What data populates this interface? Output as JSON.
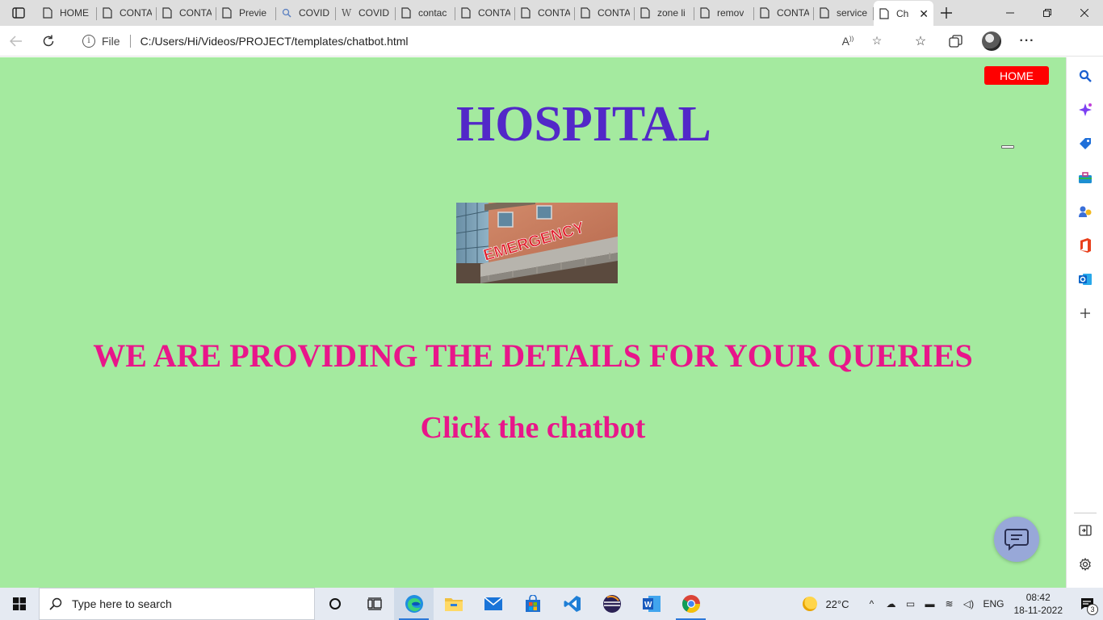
{
  "browser": {
    "tabs": [
      {
        "label": "HOME",
        "icon": "page-icon"
      },
      {
        "label": "CONTA",
        "icon": "page-icon"
      },
      {
        "label": "CONTA",
        "icon": "page-icon"
      },
      {
        "label": "Previe",
        "icon": "page-icon"
      },
      {
        "label": "COVID",
        "icon": "search-icon"
      },
      {
        "label": "COVID",
        "icon": "wikipedia-icon"
      },
      {
        "label": "contac",
        "icon": "page-icon"
      },
      {
        "label": "CONTA",
        "icon": "page-icon"
      },
      {
        "label": "CONTA",
        "icon": "page-icon"
      },
      {
        "label": "CONTA",
        "icon": "page-icon"
      },
      {
        "label": "zone li",
        "icon": "page-icon"
      },
      {
        "label": "remov",
        "icon": "page-icon"
      },
      {
        "label": "CONTA",
        "icon": "page-icon"
      },
      {
        "label": "service",
        "icon": "page-icon"
      }
    ],
    "active_tab": {
      "label": "Ch",
      "icon": "page-icon"
    },
    "address": {
      "scheme_label": "File",
      "url": "C:/Users/Hi/Videos/PROJECT/templates/chatbot.html"
    }
  },
  "page": {
    "home_button": "HOME",
    "title": "HOSPITAL",
    "image": {
      "sign_text": "EMERGENCY"
    },
    "tagline": "WE ARE PROVIDING THE DETAILS FOR YOUR QUERIES",
    "cta": "Click the chatbot",
    "colors": {
      "background": "#a4ea9f",
      "title": "#5228c8",
      "tagline": "#e8168a",
      "home_button": "#ff0000",
      "chat_fab": "#98a8d8"
    }
  },
  "edge_sidebar": {
    "items": [
      "search-icon",
      "copilot-icon",
      "shopping-tag-icon",
      "tools-icon",
      "games-icon",
      "office-icon",
      "outlook-icon",
      "add-icon"
    ],
    "bottom_items": [
      "split-screen-icon",
      "settings-icon"
    ]
  },
  "taskbar": {
    "search_placeholder": "Type here to search",
    "apps": [
      "cortana-icon",
      "task-view-icon",
      "edge-icon",
      "file-explorer-icon",
      "mail-icon",
      "store-icon",
      "vscode-icon",
      "eclipse-icon",
      "word-icon",
      "chrome-icon"
    ],
    "weather_temp": "22°C",
    "language": "ENG",
    "time": "08:42",
    "date": "18-11-2022",
    "notification_count": "3"
  }
}
